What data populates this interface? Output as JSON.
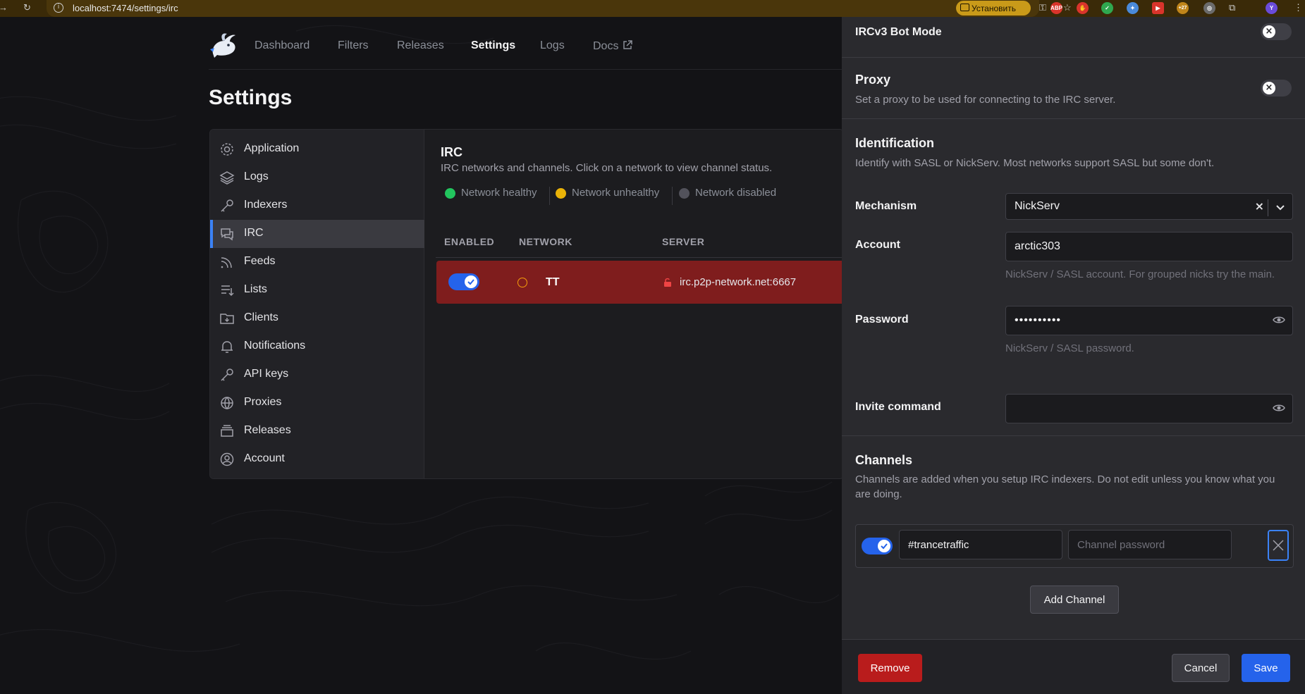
{
  "browser": {
    "url": "localhost:7474/settings/irc",
    "install_label": "Установить",
    "ext_badge": "+27",
    "ext_abp": "ABP",
    "profile_initial": "Y"
  },
  "nav": {
    "items": [
      "Dashboard",
      "Filters",
      "Releases",
      "Settings",
      "Logs",
      "Docs"
    ],
    "active": "Settings"
  },
  "page": {
    "title": "Settings"
  },
  "sidebar": {
    "items": [
      {
        "label": "Application",
        "icon": "gear-icon"
      },
      {
        "label": "Logs",
        "icon": "layers-icon"
      },
      {
        "label": "Indexers",
        "icon": "key-icon"
      },
      {
        "label": "IRC",
        "icon": "chat-icon",
        "active": true
      },
      {
        "label": "Feeds",
        "icon": "rss-icon"
      },
      {
        "label": "Lists",
        "icon": "list-icon"
      },
      {
        "label": "Clients",
        "icon": "folder-download-icon"
      },
      {
        "label": "Notifications",
        "icon": "bell-icon"
      },
      {
        "label": "API keys",
        "icon": "key-icon"
      },
      {
        "label": "Proxies",
        "icon": "globe-icon"
      },
      {
        "label": "Releases",
        "icon": "archive-icon"
      },
      {
        "label": "Account",
        "icon": "user-circle-icon"
      }
    ]
  },
  "irc": {
    "title": "IRC",
    "description": "IRC networks and channels. Click on a network to view channel status.",
    "legend": [
      {
        "label": "Network healthy",
        "color": "#22c55e"
      },
      {
        "label": "Network unhealthy",
        "color": "#eab308"
      },
      {
        "label": "Network disabled",
        "color": "#52525b"
      }
    ],
    "columns": [
      "ENABLED",
      "NETWORK",
      "SERVER"
    ],
    "networks": [
      {
        "name": "TT",
        "server": "irc.p2p-network.net:6667",
        "enabled": true,
        "status_color": "#7f1d1d"
      }
    ]
  },
  "form": {
    "bot_mode_label": "IRCv3 Bot Mode",
    "proxy": {
      "title": "Proxy",
      "description": "Set a proxy to be used for connecting to the IRC server."
    },
    "identification": {
      "title": "Identification",
      "description": "Identify with SASL or NickServ. Most networks support SASL but some don't."
    },
    "mechanism": {
      "label": "Mechanism",
      "value": "NickServ"
    },
    "account": {
      "label": "Account",
      "value": "arctic303",
      "help": "NickServ / SASL account. For grouped nicks try the main."
    },
    "password": {
      "label": "Password",
      "value": "••••••••••",
      "help": "NickServ / SASL password."
    },
    "invite": {
      "label": "Invite command",
      "value": ""
    },
    "channels": {
      "title": "Channels",
      "description": "Channels are added when you setup IRC indexers. Do not edit unless you know what you are doing.",
      "items": [
        {
          "name": "#trancetraffic",
          "password_placeholder": "Channel password",
          "enabled": true
        }
      ],
      "add_label": "Add Channel"
    },
    "actions": {
      "remove": "Remove",
      "cancel": "Cancel",
      "save": "Save"
    }
  },
  "colors": {
    "accent": "#2563eb",
    "danger": "#b91c1c"
  }
}
